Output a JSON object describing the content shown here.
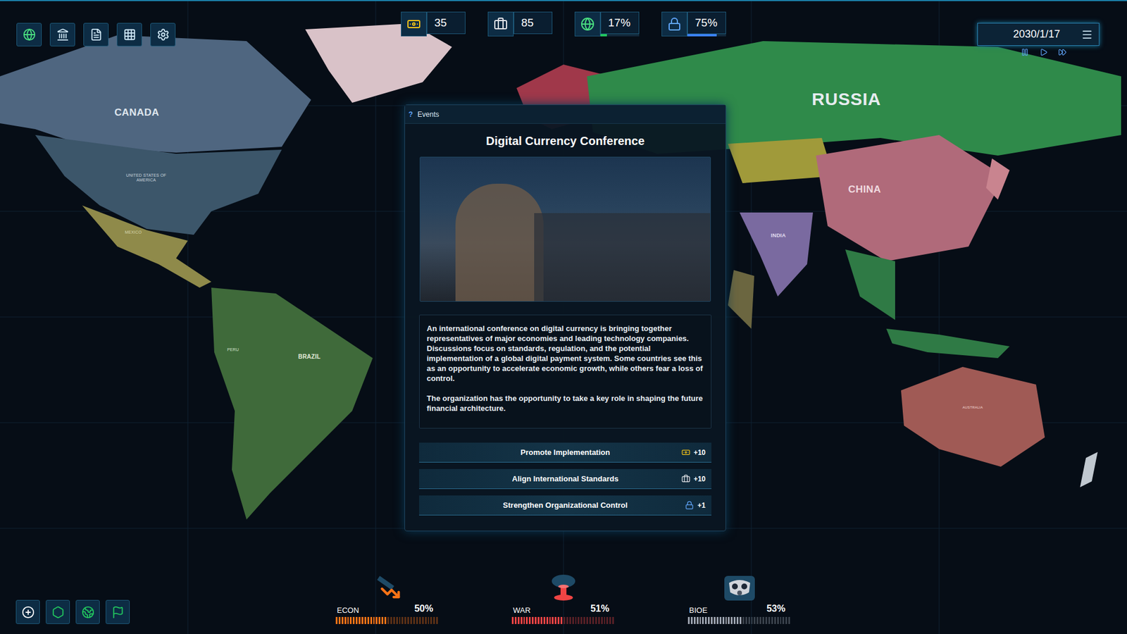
{
  "resources": [
    {
      "kind": "money",
      "value": "35"
    },
    {
      "kind": "staff",
      "value": "85"
    },
    {
      "kind": "influence",
      "value": "17%",
      "level": 0.17,
      "color": "#22c55e"
    },
    {
      "kind": "security",
      "value": "75%",
      "level": 0.75,
      "color": "#3b82f6"
    }
  ],
  "clock": {
    "date": "2030/1/17"
  },
  "map": {
    "labels": [
      {
        "text": "CANADA"
      },
      {
        "text": "UNITED STATES OF AMERICA"
      },
      {
        "text": "MEXICO"
      },
      {
        "text": "PERU"
      },
      {
        "text": "BRAZIL"
      },
      {
        "text": "RUSSIA"
      },
      {
        "text": "CHINA"
      },
      {
        "text": "INDIA"
      },
      {
        "text": "AUSTRALIA"
      }
    ]
  },
  "event": {
    "header_icon": "?",
    "header": "Events",
    "title": "Digital Currency Conference",
    "paragraphs": [
      "An international conference on digital currency is bringing together representatives of major economies and leading technology companies. Discussions focus on standards, regulation, and the potential implementation of a global digital payment system. Some countries see this as an opportunity to accelerate economic growth, while others fear a loss of control.",
      "The organization has the opportunity to take a key role in shaping the future financial architecture."
    ],
    "options": [
      {
        "label": "Promote Implementation",
        "reward": "+10",
        "kind": "money",
        "selected": false
      },
      {
        "label": "Align International Standards",
        "reward": "+10",
        "kind": "staff",
        "selected": false
      },
      {
        "label": "Strengthen Organizational Control",
        "reward": "+1",
        "kind": "security",
        "selected": false
      }
    ]
  },
  "meters": [
    {
      "label": "ECON",
      "reading": "50%",
      "level": 0.5,
      "color": "#f97316",
      "kind": "econ"
    },
    {
      "label": "WAR",
      "reading": "51%",
      "level": 0.51,
      "color": "#ef4444",
      "kind": "war"
    },
    {
      "label": "BIOE",
      "reading": "53%",
      "level": 0.53,
      "color": "#9ca3af",
      "kind": "bioe"
    }
  ]
}
